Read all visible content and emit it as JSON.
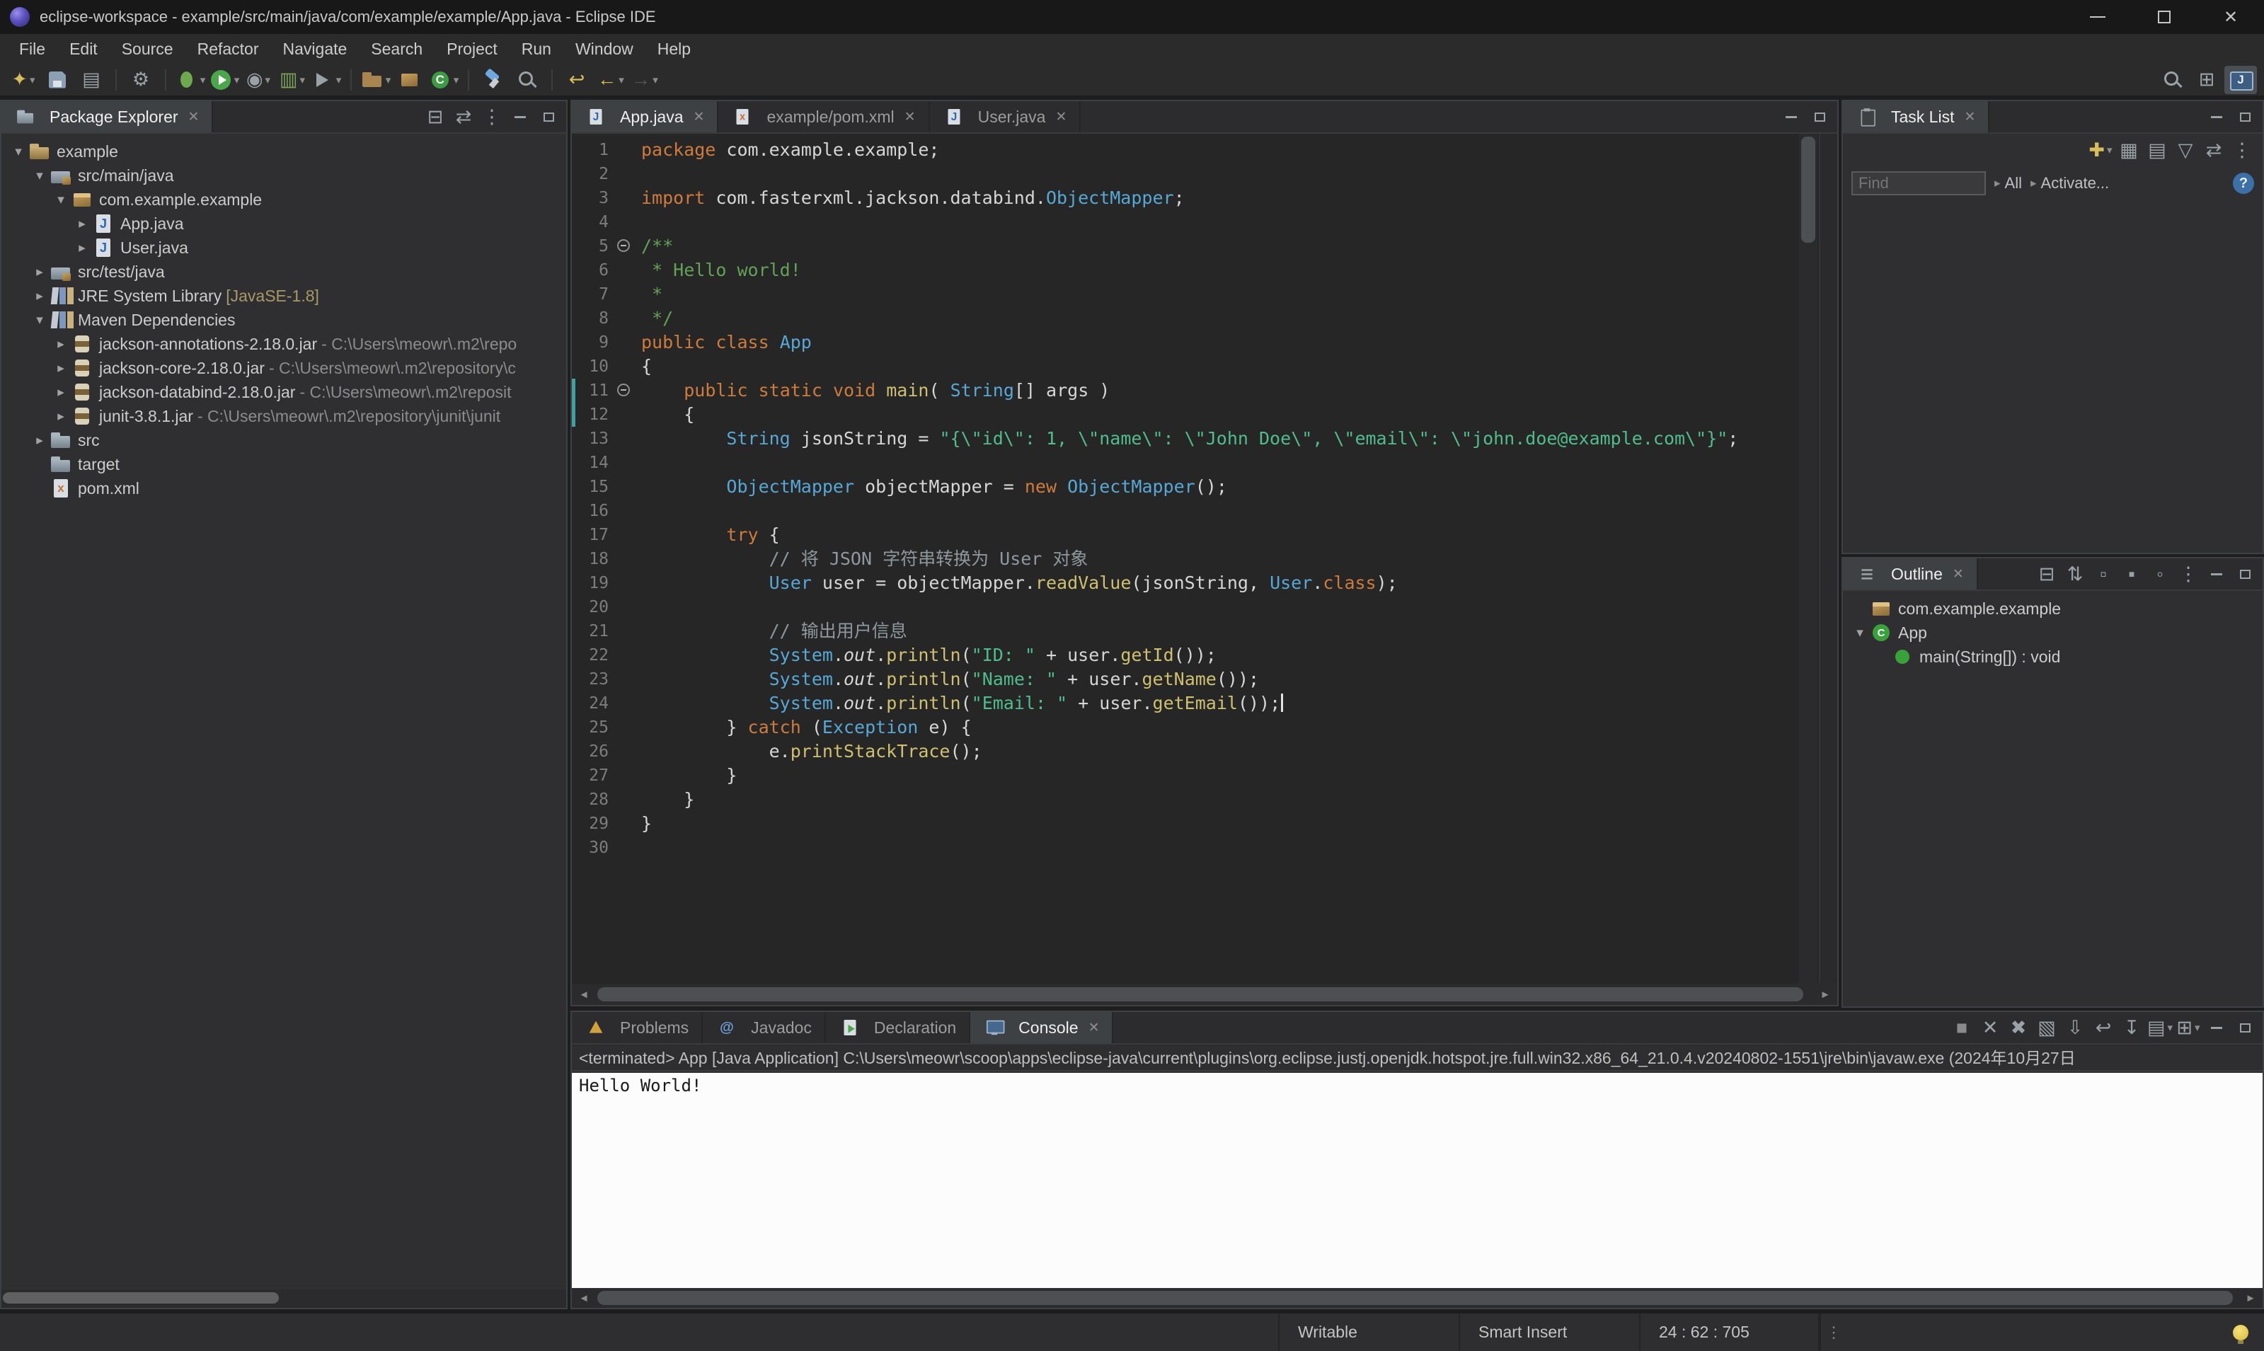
{
  "colors": {
    "keyword": "#CE7B3C",
    "type": "#56A8D6",
    "string": "#4FBD8D",
    "comment_javadoc": "#62A257",
    "comment_line": "#8E989E",
    "method": "#CFC06F",
    "field": "#D7D7D7",
    "text": "#D6D6D6",
    "line_number": "#7D7D7D"
  },
  "icons": {
    "close": "✕",
    "dropdown": "▾",
    "expanded": "▾",
    "collapsed": "▸",
    "scroll_left": "◄",
    "scroll_right": "►",
    "menu_dots": "⋮",
    "help": "?",
    "letters": {
      "java-file": "J",
      "xml-file": "x",
      "class": "C",
      "new-class": "C",
      "java-perspective": "J",
      "javadoc": "@"
    }
  },
  "window": {
    "title": "eclipse-workspace - example/src/main/java/com/example/example/App.java - Eclipse IDE"
  },
  "menu": {
    "items": [
      "File",
      "Edit",
      "Source",
      "Refactor",
      "Navigate",
      "Search",
      "Project",
      "Run",
      "Window",
      "Help"
    ]
  },
  "toolbar": {
    "buttons": [
      {
        "name": "new-wizard",
        "glyph": "✦",
        "color": "#D8BC5A",
        "dropdown": true
      },
      {
        "name": "save",
        "shape": "floppy",
        "color": "#8CA0B4"
      },
      {
        "name": "print",
        "glyph": "▤",
        "color": "#9AA2A8"
      },
      {
        "sep": true
      },
      {
        "name": "build-all",
        "glyph": "⚙",
        "color": "#9AA2A8"
      },
      {
        "sep": true
      },
      {
        "name": "debug",
        "shape": "bug",
        "color": "#6EA94E",
        "dropdown": true
      },
      {
        "name": "run",
        "shape": "run",
        "color": "#4CA64C",
        "dropdown": true
      },
      {
        "name": "profile",
        "glyph": "◉",
        "color": "#9AA2A8",
        "dropdown": true
      },
      {
        "name": "coverage",
        "glyph": "▥",
        "color": "#7CA65C",
        "dropdown": true
      },
      {
        "name": "external-tools",
        "shape": "run-ext",
        "color": "#9AA2A8",
        "dropdown": true
      },
      {
        "sep": true
      },
      {
        "name": "new-java-project",
        "shape": "folder",
        "color": "#A8854F",
        "dropdown": true
      },
      {
        "name": "new-package",
        "shape": "package",
        "color": "#A8854F"
      },
      {
        "name": "new-class",
        "shape": "class",
        "color": "#3C9B43",
        "dropdown": true
      },
      {
        "sep": true
      },
      {
        "name": "open-type",
        "shape": "flashlight",
        "color": "#6FA8DC"
      },
      {
        "name": "search",
        "shape": "magnifier",
        "color": "#9AA2A8"
      },
      {
        "sep": true
      },
      {
        "name": "last-edit-location",
        "glyph": "↩",
        "color": "#D8BC5A"
      },
      {
        "name": "back",
        "glyph": "←",
        "color": "#D8BC5A",
        "dropdown": true
      },
      {
        "name": "forward",
        "glyph": "→",
        "color": "#7A7A7A",
        "dropdown": true,
        "dim": true
      }
    ],
    "right": [
      {
        "name": "search-toolbar",
        "shape": "magnifier",
        "color": "#9AA2A8"
      },
      {
        "name": "open-perspective",
        "glyph": "⊞",
        "color": "#9AA2A8"
      },
      {
        "name": "java-perspective",
        "shape": "perspective-java",
        "color": "#7FB0E8",
        "active": true
      }
    ]
  },
  "package_explorer": {
    "title": "Package Explorer",
    "toolbar": [
      {
        "name": "collapse-all",
        "glyph": "⊟"
      },
      {
        "name": "link-with-editor",
        "glyph": "⇄"
      },
      {
        "name": "view-menu",
        "glyph": "⋮"
      }
    ],
    "items": [
      {
        "label": "example",
        "level": 0,
        "state": "expanded",
        "icon": "project"
      },
      {
        "label": "src/main/java",
        "level": 1,
        "state": "expanded",
        "icon": "source-folder"
      },
      {
        "label": "com.example.example",
        "level": 2,
        "state": "expanded",
        "icon": "package"
      },
      {
        "label": "App.java",
        "level": 3,
        "state": "collapsed",
        "icon": "java-file"
      },
      {
        "label": "User.java",
        "level": 3,
        "state": "collapsed",
        "icon": "java-file"
      },
      {
        "label": "src/test/java",
        "level": 1,
        "state": "collapsed",
        "icon": "source-folder"
      },
      {
        "label": "JRE System Library",
        "detail": "[JavaSE-1.8]",
        "detail_gold": true,
        "level": 1,
        "state": "collapsed",
        "icon": "library"
      },
      {
        "label": "Maven Dependencies",
        "level": 1,
        "state": "expanded",
        "icon": "library"
      },
      {
        "label": "jackson-annotations-2.18.0.jar",
        "detail": "- C:\\Users\\meowr\\.m2\\repo",
        "level": 2,
        "state": "collapsed",
        "icon": "jar"
      },
      {
        "label": "jackson-core-2.18.0.jar",
        "detail": "- C:\\Users\\meowr\\.m2\\repository\\c",
        "level": 2,
        "state": "collapsed",
        "icon": "jar"
      },
      {
        "label": "jackson-databind-2.18.0.jar",
        "detail": "- C:\\Users\\meowr\\.m2\\reposit",
        "level": 2,
        "state": "collapsed",
        "icon": "jar"
      },
      {
        "label": "junit-3.8.1.jar",
        "detail": "- C:\\Users\\meowr\\.m2\\repository\\junit\\junit",
        "level": 2,
        "state": "collapsed",
        "icon": "jar"
      },
      {
        "label": "src",
        "level": 1,
        "state": "collapsed",
        "icon": "folder"
      },
      {
        "label": "target",
        "level": 1,
        "state": "none",
        "icon": "folder"
      },
      {
        "label": "pom.xml",
        "level": 1,
        "state": "none",
        "icon": "xml-file"
      }
    ]
  },
  "editor": {
    "tabs": [
      {
        "label": "App.java",
        "icon": "java-file",
        "active": true,
        "closable": true
      },
      {
        "label": "example/pom.xml",
        "icon": "xml-file",
        "active": false,
        "closable": true
      },
      {
        "label": "User.java",
        "icon": "java-file",
        "active": false,
        "closable": true
      }
    ],
    "lines": [
      "package com.example.example;",
      "",
      "import com.fasterxml.jackson.databind.ObjectMapper;",
      "",
      "/**",
      " * Hello world!",
      " *",
      " */",
      "public class App",
      "{",
      "    public static void main( String[] args )",
      "    {",
      "        String jsonString = \"{\\\"id\\\": 1, \\\"name\\\": \\\"John Doe\\\", \\\"email\\\": \\\"john.doe@example.com\\\"}\";",
      "",
      "        ObjectMapper objectMapper = new ObjectMapper();",
      "",
      "        try {",
      "            // 将 JSON 字符串转换为 User 对象",
      "            User user = objectMapper.readValue(jsonString, User.class);",
      "",
      "            // 输出用户信息",
      "            System.out.println(\"ID: \" + user.getId());",
      "            System.out.println(\"Name: \" + user.getName());",
      "            System.out.println(\"Email: \" + user.getEmail());",
      "        } catch (Exception e) {",
      "            e.printStackTrace();",
      "        }",
      "    }",
      "}",
      ""
    ],
    "fold_markers": [
      5,
      11
    ],
    "changed_lines": [
      11,
      12
    ],
    "cursor": {
      "line": 24
    }
  },
  "task_list": {
    "title": "Task List",
    "toolbar": [
      {
        "name": "new-task",
        "glyph": "✚",
        "color": "#D8BC5A",
        "dropdown": true
      },
      {
        "name": "categorized",
        "glyph": "▦"
      },
      {
        "name": "schedule",
        "glyph": "▤"
      },
      {
        "name": "filter",
        "glyph": "▽"
      },
      {
        "name": "link-with-editor",
        "glyph": "⇄"
      },
      {
        "name": "view-menu",
        "glyph": "⋮"
      }
    ],
    "find_placeholder": "Find",
    "scope_all": "All",
    "activate": "Activate..."
  },
  "outline": {
    "title": "Outline",
    "toolbar": [
      {
        "name": "collapse-all",
        "glyph": "⊟"
      },
      {
        "name": "sort",
        "glyph": "⇅"
      },
      {
        "name": "hide-fields",
        "glyph": "▫"
      },
      {
        "name": "hide-static",
        "glyph": "▪"
      },
      {
        "name": "hide-non-public",
        "glyph": "◦"
      },
      {
        "name": "view-menu",
        "glyph": "⋮"
      }
    ],
    "items": [
      {
        "label": "com.example.example",
        "icon": "package-decl",
        "level": 0,
        "state": "none"
      },
      {
        "label": "App",
        "icon": "class",
        "level": 0,
        "state": "expanded"
      },
      {
        "label": "main(String[]) : void",
        "icon": "method",
        "level": 1,
        "state": "none"
      }
    ]
  },
  "bottom_panel": {
    "tabs": [
      {
        "label": "Problems",
        "icon": "problems",
        "active": false
      },
      {
        "label": "Javadoc",
        "icon": "javadoc",
        "active": false
      },
      {
        "label": "Declaration",
        "icon": "declaration",
        "active": false
      },
      {
        "label": "Console",
        "icon": "console",
        "active": true,
        "closable": true
      }
    ],
    "toolbar": [
      {
        "name": "terminate",
        "glyph": "■",
        "color": "#8A8A8A"
      },
      {
        "name": "remove-launch",
        "glyph": "✕"
      },
      {
        "name": "remove-all-terminated",
        "glyph": "✖"
      },
      {
        "name": "clear-console",
        "glyph": "▧"
      },
      {
        "name": "scroll-lock",
        "glyph": "⇩"
      },
      {
        "name": "word-wrap",
        "glyph": "↩"
      },
      {
        "name": "pin-console",
        "glyph": "↧"
      },
      {
        "name": "show-console-on-output",
        "glyph": "▤",
        "dropdown": true
      },
      {
        "name": "open-console",
        "glyph": "⊞",
        "dropdown": true
      }
    ],
    "console_header": "<terminated> App [Java Application] C:\\Users\\meowr\\scoop\\apps\\eclipse-java\\current\\plugins\\org.eclipse.justj.openjdk.hotspot.jre.full.win32.x86_64_21.0.4.v20240802-1551\\jre\\bin\\javaw.exe (2024年10月27日",
    "console_output": "Hello World!"
  },
  "status_bar": {
    "writable": "Writable",
    "input_mode": "Smart Insert",
    "caret_position": "24 : 62 : 705"
  }
}
